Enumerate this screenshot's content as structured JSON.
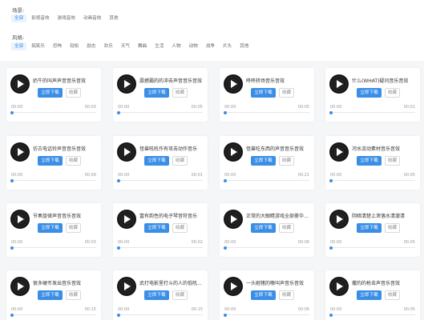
{
  "filters": {
    "scene_label": "场景:",
    "scene_options": [
      "全部",
      "影视音效",
      "游戏音效",
      "动画音效",
      "其他"
    ],
    "style_label": "风格:",
    "style_options": [
      "全部",
      "搞笑乐",
      "恐怖",
      "轻松",
      "励志",
      "欢乐",
      "天气",
      "舞曲",
      "生活",
      "人物",
      "动物",
      "战争",
      "片头",
      "其他"
    ]
  },
  "colors": {
    "accent": "#3a8ee6",
    "active_chip_bg": "#eaf3ff"
  },
  "card_labels": {
    "download": "立即下载",
    "favorite": "收藏"
  },
  "tracks": [
    {
      "title": "奶牛的叫声声音音乐音效",
      "current": "00:00",
      "duration": "00:03"
    },
    {
      "title": "震撼霸的的冲击声音音乐音效",
      "current": "00:00",
      "duration": "00:05"
    },
    {
      "title": "咚咚转场音乐音效",
      "current": "00:00",
      "duration": "00:05"
    },
    {
      "title": "什么(WHAT)疑问音乐音效",
      "current": "00:00",
      "duration": "00:01"
    },
    {
      "title": "仿古电话铃声音音乐音效",
      "current": "00:00",
      "duration": "00:09"
    },
    {
      "title": "怪兽吼吼作有攻击动作音乐",
      "current": "00:00",
      "duration": "00:01"
    },
    {
      "title": "怪兽吃东西的声音音乐音效",
      "current": "00:00",
      "duration": "00:21"
    },
    {
      "title": "河水流动素材音乐音效",
      "current": "00:00",
      "duration": "00:05"
    },
    {
      "title": "节奏旋律声音音乐音效",
      "current": "00:00",
      "duration": "00:03"
    },
    {
      "title": "富有韵性的电子琴音符音乐",
      "current": "00:00",
      "duration": "00:02"
    },
    {
      "title": "正常的大眼睛游戏全部豪华音效",
      "current": "00:00",
      "duration": "00:06"
    },
    {
      "title": "阴暗清楚上泄落水清澈清",
      "current": "00:00",
      "duration": "00:05"
    },
    {
      "title": "很多硬币发出音乐音效",
      "current": "00:00",
      "duration": "00:15"
    },
    {
      "title": "武打电影里打斗的人的低吼音效",
      "current": "00:00",
      "duration": "00:15"
    },
    {
      "title": "一头砸猪的嗷叫声音乐音效",
      "current": "00:00",
      "duration": "00:06"
    },
    {
      "title": "撒的的枪击声音乐音效",
      "current": "00:00",
      "duration": "00:05"
    }
  ]
}
